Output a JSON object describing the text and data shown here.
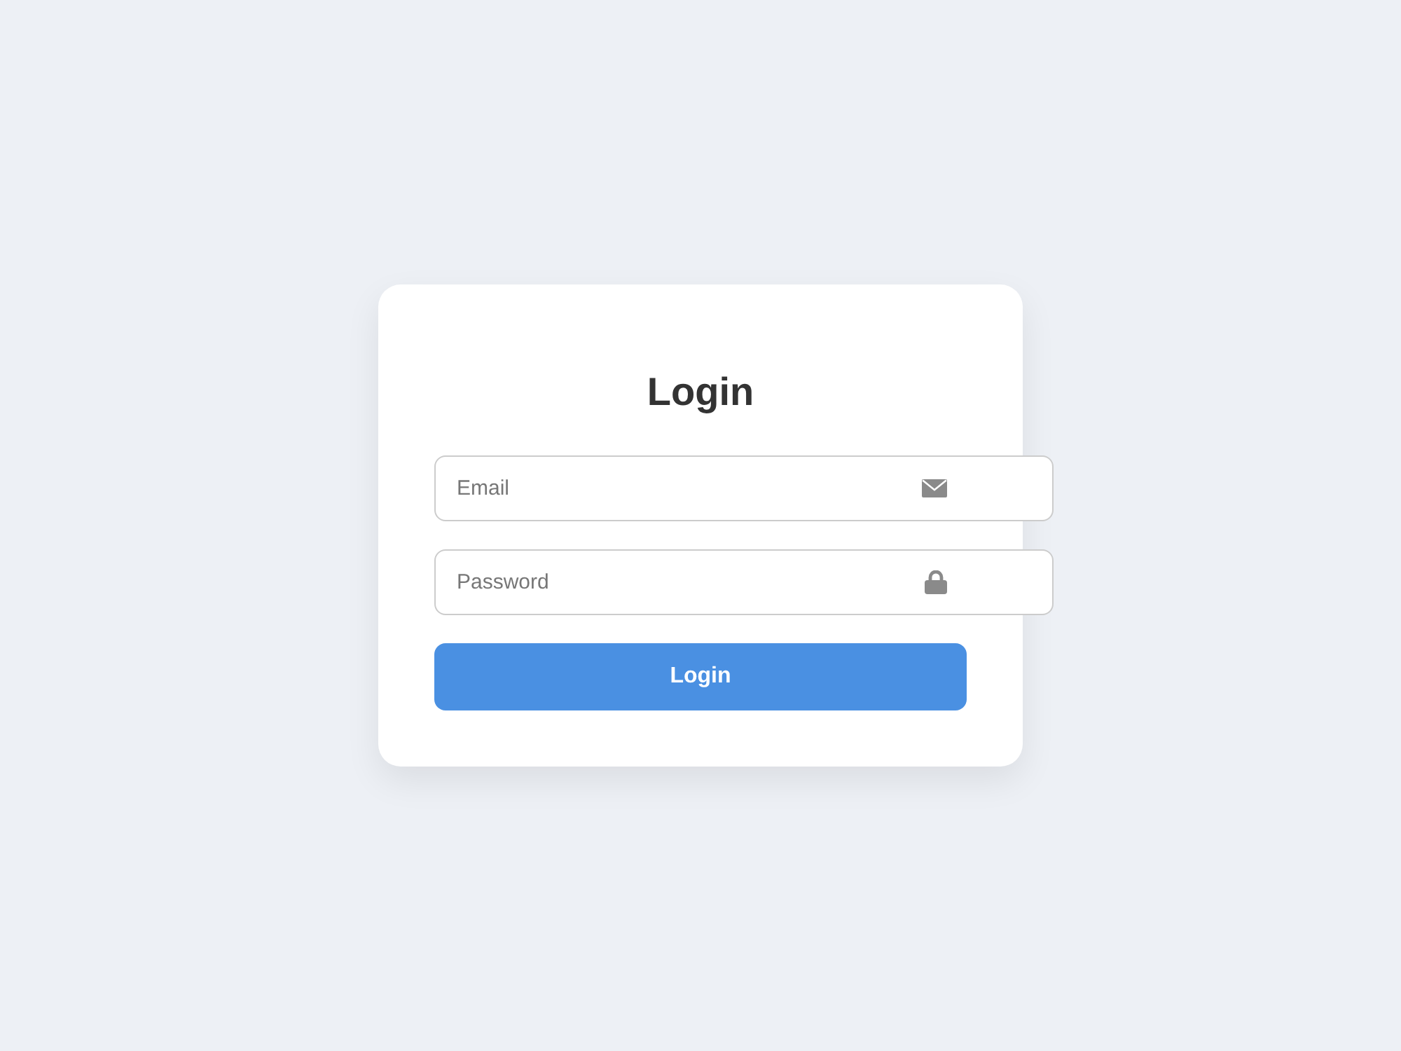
{
  "card": {
    "title": "Login"
  },
  "fields": [
    {
      "kind": "email",
      "placeholder": "Email"
    },
    {
      "kind": "password",
      "placeholder": "Password"
    }
  ],
  "button": {
    "label": "Login"
  }
}
